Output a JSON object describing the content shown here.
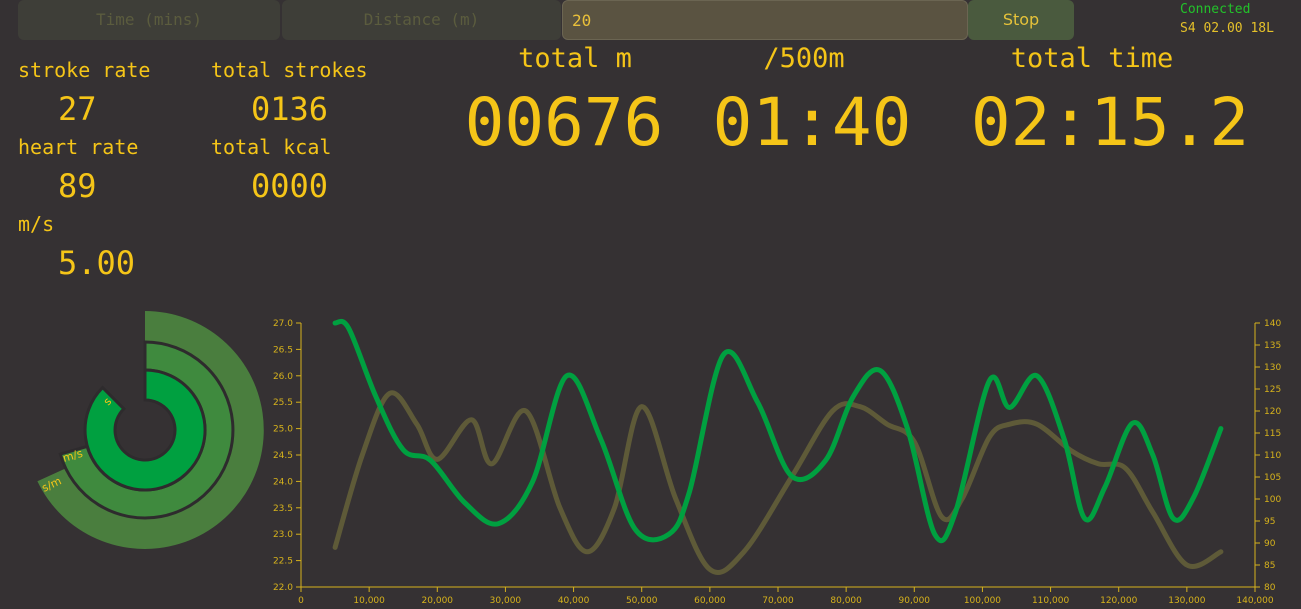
{
  "controls": {
    "time_placeholder": "Time (mins)",
    "distance_placeholder": "Distance (m)",
    "goal_value": "20",
    "stop_label": "Stop"
  },
  "status": {
    "connection": "Connected",
    "device": "S4 02.00 18L"
  },
  "metrics": {
    "stroke_rate_label": "stroke rate",
    "stroke_rate": "27",
    "total_strokes_label": "total strokes",
    "total_strokes": "0136",
    "heart_rate_label": "heart rate",
    "heart_rate": "89",
    "total_kcal_label": "total kcal",
    "total_kcal": "0000",
    "speed_label": "m/s",
    "speed": "5.00"
  },
  "totals": {
    "distance_label": "total m",
    "distance": "00676",
    "split_label": "/500m",
    "split": "01:40",
    "time_label": "total time",
    "time": "02:15.2"
  },
  "radial": {
    "rings": [
      "s",
      "m/s",
      "s/m"
    ]
  },
  "chart_data": {
    "type": "line",
    "x_ticks": [
      "0",
      "10,000",
      "20,000",
      "30,000",
      "40,000",
      "50,000",
      "60,000",
      "70,000",
      "80,000",
      "90,000",
      "100,000",
      "110,000",
      "120,000",
      "130,000",
      "140,000"
    ],
    "xlim": [
      0,
      140000
    ],
    "y_left_ticks": [
      "22.0",
      "22.5",
      "23.0",
      "23.5",
      "24.0",
      "24.5",
      "25.0",
      "25.5",
      "26.0",
      "26.5",
      "27.0"
    ],
    "ylim_left": [
      22,
      27
    ],
    "y_right_ticks": [
      "80",
      "85",
      "90",
      "95",
      "100",
      "105",
      "110",
      "115",
      "120",
      "125",
      "130",
      "135",
      "140"
    ],
    "ylim_right": [
      80,
      140
    ],
    "series": [
      {
        "color": "#00a040",
        "axis": "left",
        "x": [
          5000,
          7000,
          11000,
          15000,
          19000,
          24000,
          29000,
          34000,
          39000,
          44000,
          49000,
          54000,
          57000,
          62000,
          67000,
          72000,
          77000,
          81000,
          85000,
          89000,
          93000,
          96000,
          101000,
          104000,
          108000,
          112000,
          115000,
          118000,
          122000,
          125000,
          128000,
          131000,
          135000
        ],
        "y": [
          27.0,
          26.9,
          25.6,
          24.6,
          24.4,
          23.6,
          23.2,
          24.0,
          26.0,
          24.8,
          23.1,
          23.0,
          23.8,
          26.4,
          25.5,
          24.1,
          24.4,
          25.6,
          26.1,
          25.0,
          23.0,
          23.4,
          25.9,
          25.4,
          26.0,
          24.8,
          23.3,
          23.9,
          25.1,
          24.5,
          23.3,
          23.7,
          25.0
        ]
      },
      {
        "color": "#5e5a38",
        "axis": "right",
        "x": [
          5000,
          9000,
          13000,
          17000,
          20000,
          25000,
          28000,
          33000,
          38000,
          42000,
          46000,
          50000,
          55000,
          60000,
          65000,
          72000,
          78000,
          82000,
          86000,
          90000,
          94000,
          97000,
          101000,
          104000,
          108000,
          113000,
          117000,
          121000,
          125000,
          130000,
          135000
        ],
        "y": [
          89,
          110,
          124,
          117,
          109,
          118,
          108,
          120,
          98,
          88,
          98,
          121,
          100,
          84,
          88,
          105,
          120,
          121,
          117,
          113,
          96,
          100,
          114,
          117,
          117,
          111,
          108,
          107,
          97,
          85,
          88
        ]
      }
    ]
  }
}
